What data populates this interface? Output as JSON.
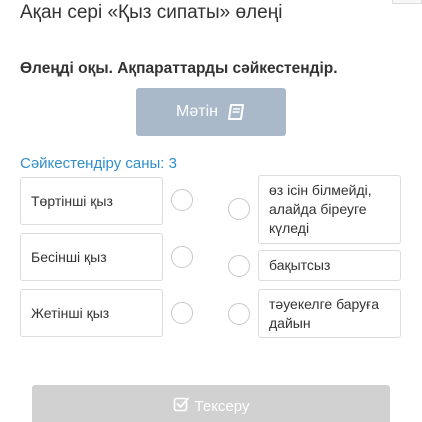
{
  "header": {
    "title": "Ақан сері «Қыз сипаты» өлеңі"
  },
  "instruction": "Өлеңді оқы. Ақпараттарды сәйкестендір.",
  "text_button": {
    "label": "Мәтін",
    "icon": "book-icon"
  },
  "match_count": "Сәйкестендіру саны: 3",
  "left_items": [
    {
      "label": "Төртінші қыз"
    },
    {
      "label": "Бесінші қыз"
    },
    {
      "label": "Жетінші қыз"
    }
  ],
  "right_items": [
    {
      "label": "өз ісін білмейді, алайда біреуге күледі"
    },
    {
      "label": "бақытсыз"
    },
    {
      "label": "тәуекелге баруға дайын"
    }
  ],
  "check_button": {
    "label": "Тексеру",
    "icon": "check-square-icon",
    "state": "disabled"
  },
  "colors": {
    "accent_text": "#2f8fc9",
    "text_button_bg": "#a9b9c9",
    "check_button_bg": "#d1d1d1"
  }
}
